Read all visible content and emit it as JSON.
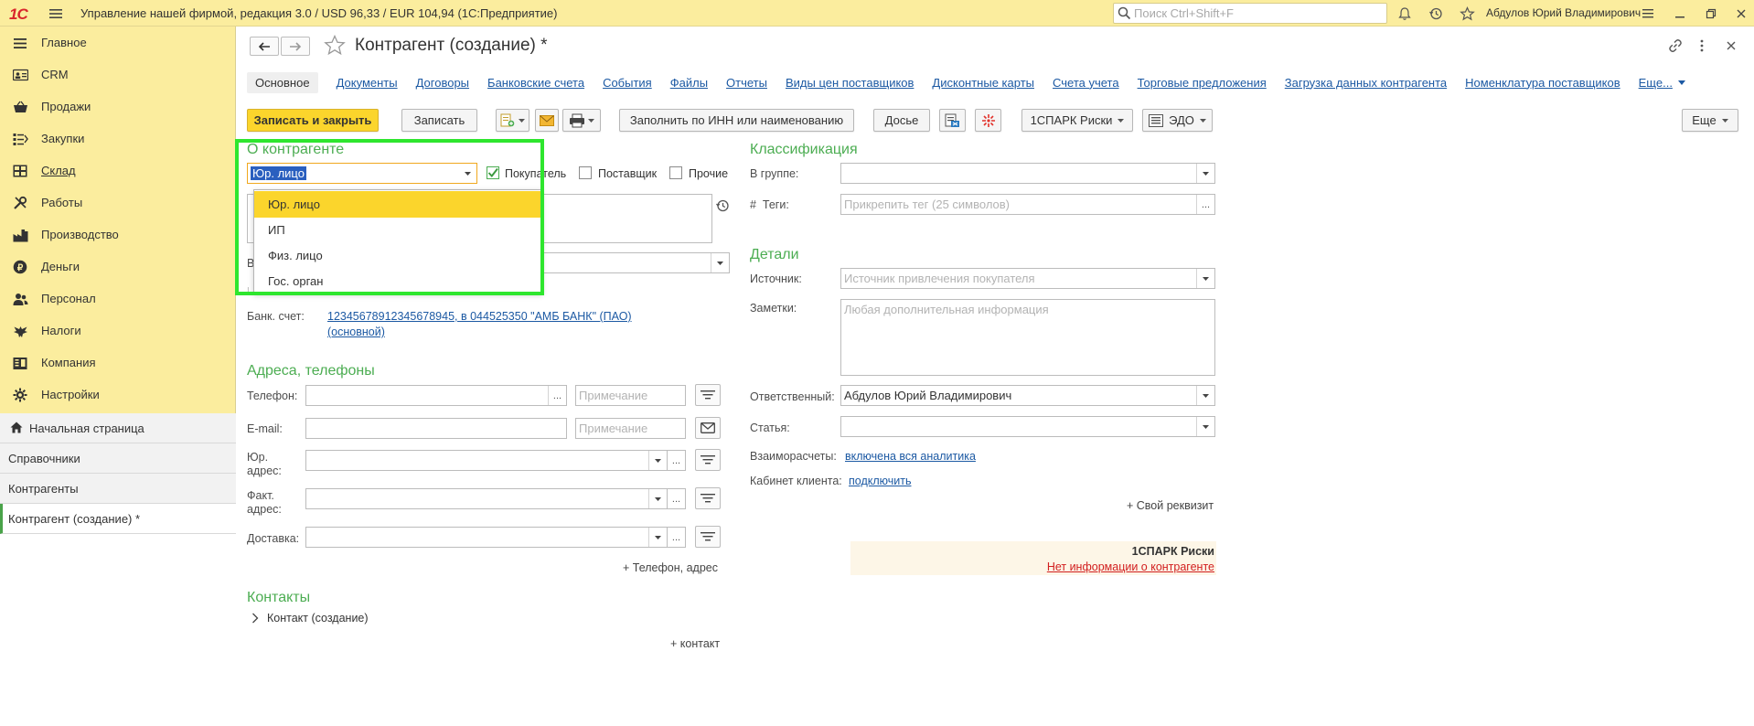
{
  "titlebar": {
    "logo": "1С",
    "title": "Управление нашей фирмой, редакция 3.0 / USD 96,33 / EUR 104,94  (1С:Предприятие)",
    "search_placeholder": "Поиск Ctrl+Shift+F",
    "user": "Абдулов Юрий Владимирович"
  },
  "sidebar": {
    "items": [
      {
        "label": "Главное",
        "icon": "menu-icon"
      },
      {
        "label": "CRM",
        "icon": "crm-icon"
      },
      {
        "label": "Продажи",
        "icon": "basket-icon"
      },
      {
        "label": "Закупки",
        "icon": "purchases-icon"
      },
      {
        "label": "Склад",
        "icon": "warehouse-icon"
      },
      {
        "label": "Работы",
        "icon": "tools-icon"
      },
      {
        "label": "Производство",
        "icon": "factory-icon"
      },
      {
        "label": "Деньги",
        "icon": "money-icon"
      },
      {
        "label": "Персонал",
        "icon": "people-icon"
      },
      {
        "label": "Налоги",
        "icon": "eagle-icon"
      },
      {
        "label": "Компания",
        "icon": "company-icon"
      },
      {
        "label": "Настройки",
        "icon": "gear-icon"
      }
    ],
    "open_windows": [
      {
        "label": "Начальная страница",
        "icon": "home-icon"
      },
      {
        "label": "Справочники"
      },
      {
        "label": "Контрагенты"
      },
      {
        "label": "Контрагент (создание) *"
      }
    ]
  },
  "form": {
    "title": "Контрагент (создание) *",
    "tabs": [
      "Основное",
      "Документы",
      "Договоры",
      "Банковские счета",
      "События",
      "Файлы",
      "Отчеты",
      "Виды цен поставщиков",
      "Дисконтные карты",
      "Счета учета",
      "Торговые предложения",
      "Загрузка данных контрагента",
      "Номенклатура поставщиков",
      "Еще..."
    ],
    "toolbar": {
      "save_close": "Записать и закрыть",
      "save": "Записать",
      "fill_inn": "Заполнить по ИНН или наименованию",
      "dossier": "Досье",
      "spark": "1СПАРК Риски",
      "edo": "ЭДО",
      "more": "Еще"
    },
    "about": {
      "header": "О контрагенте",
      "type_value": "Юр. лицо",
      "buyer": "Покупатель",
      "buyer_checked": true,
      "supplier": "Поставщик",
      "other": "Прочие",
      "cut_label_1": "В",
      "cut_label_2": "I"
    },
    "dropdown_options": [
      "Юр. лицо",
      "ИП",
      "Физ. лицо",
      "Гос. орган"
    ],
    "bank": {
      "label": "Банк. счет:",
      "value_line1": "12345678912345678945, в 044525350 \"АМБ БАНК\" (ПАО)",
      "value_line2": "(основной)"
    },
    "addresses": {
      "header": "Адреса, телефоны",
      "phone": "Телефон:",
      "email": "E-mail:",
      "legal": "Юр. адрес:",
      "fact": "Факт. адрес:",
      "delivery": "Доставка:",
      "note_placeholder": "Примечание",
      "add_phone": "+ Телефон, адрес"
    },
    "contacts": {
      "header": "Контакты",
      "item": "Контакт (создание)",
      "add": "+ контакт"
    },
    "classification": {
      "header": "Классификация",
      "group": "В группе:",
      "tags": "Теги:",
      "tags_placeholder": "Прикрепить тег (25 символов)"
    },
    "details": {
      "header": "Детали",
      "source": "Источник:",
      "source_placeholder": "Источник привлечения покупателя",
      "notes": "Заметки:",
      "notes_placeholder": "Любая дополнительная информация",
      "responsible": "Ответственный:",
      "responsible_value": "Абдулов Юрий Владимирович",
      "article": "Статья:",
      "settlements": "Взаиморасчеты:",
      "settlements_link": "включена вся аналитика",
      "cabinet": "Кабинет клиента:",
      "cabinet_link": "подключить",
      "custom": "+ Свой реквизит"
    },
    "spark_panel": {
      "title": "1СПАРК Риски",
      "no_info": "Нет информации о контрагенте"
    }
  }
}
